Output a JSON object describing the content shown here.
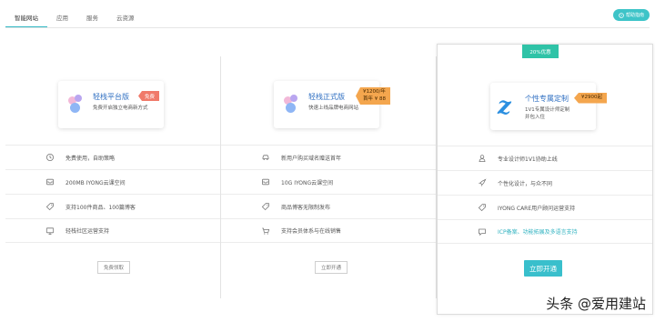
{
  "tabs": [
    {
      "label": "智能网站",
      "active": true
    },
    {
      "label": "应用",
      "active": false
    },
    {
      "label": "服务",
      "active": false
    },
    {
      "label": "云资源",
      "active": false
    }
  ],
  "help_button": {
    "label": "帮助指南",
    "icon": "help-icon"
  },
  "plans": [
    {
      "name": "轻栈平台版",
      "desc": "免费开启独立电商新方式",
      "tag": "免费",
      "features": [
        {
          "icon": "clock-icon",
          "text": "免费使用，自助策略"
        },
        {
          "icon": "storage-icon",
          "text": "200MB IYONG云课空间"
        },
        {
          "icon": "tag-icon",
          "text": "支持100件商品、100篇博客"
        },
        {
          "icon": "monitor-icon",
          "text": "轻栈社区运营支持"
        }
      ],
      "button": "免费领取"
    },
    {
      "name": "轻栈正式版",
      "desc": "快速上线品牌电商网站",
      "tag_line1": "¥1200/年",
      "tag_line2": "首年 ¥ 88",
      "features": [
        {
          "icon": "car-icon",
          "text": "新用户购买域名赠送首年"
        },
        {
          "icon": "storage-icon",
          "text": "10G IYONG云课空间"
        },
        {
          "icon": "tag-icon",
          "text": "商品博客无限制发布"
        },
        {
          "icon": "cart-icon",
          "text": "支持会员体系与在线销售"
        }
      ],
      "button": "立即开通"
    },
    {
      "name": "个性专属定制",
      "desc_line1": "1V1专属设计师定制",
      "desc_line2": "并包入住",
      "tag": "¥2900起",
      "promo": "20%优惠",
      "features": [
        {
          "icon": "user-icon",
          "text": "专业设计师1V1协助上线",
          "link": false
        },
        {
          "icon": "rocket-icon",
          "text": "个性化设计，与众不同",
          "link": false
        },
        {
          "icon": "tag-icon",
          "text": "IYONG CARE用户顾问运营支持",
          "link": false
        },
        {
          "icon": "chat-icon",
          "text": "ICP备案、功能拓展及多语言支持",
          "link": true
        }
      ],
      "button": "立即开通"
    }
  ],
  "watermark": "头条 @爱用建站",
  "colors": {
    "accent": "#39bfcc",
    "promo": "#2fc3a7",
    "free_tag": "#f07a6a",
    "price_tag": "#f4a64e",
    "title": "#2f6fc2"
  }
}
